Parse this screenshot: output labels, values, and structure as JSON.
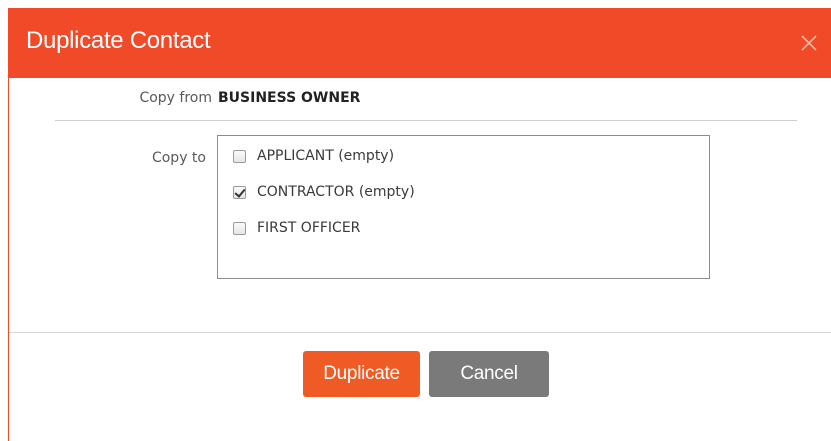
{
  "dialog": {
    "title": "Duplicate Contact",
    "close_icon": "close-icon",
    "accent_color": "#f04a28"
  },
  "copy_from": {
    "label": "Copy from",
    "value": "BUSINESS OWNER"
  },
  "copy_to": {
    "label": "Copy to",
    "options": [
      {
        "label": "APPLICANT (empty)",
        "checked": false
      },
      {
        "label": "CONTRACTOR (empty)",
        "checked": true
      },
      {
        "label": "FIRST OFFICER",
        "checked": false
      }
    ]
  },
  "buttons": {
    "duplicate_label": "Duplicate",
    "duplicate_color": "#f05a24",
    "cancel_label": "Cancel",
    "cancel_color": "#7a7a7a"
  }
}
